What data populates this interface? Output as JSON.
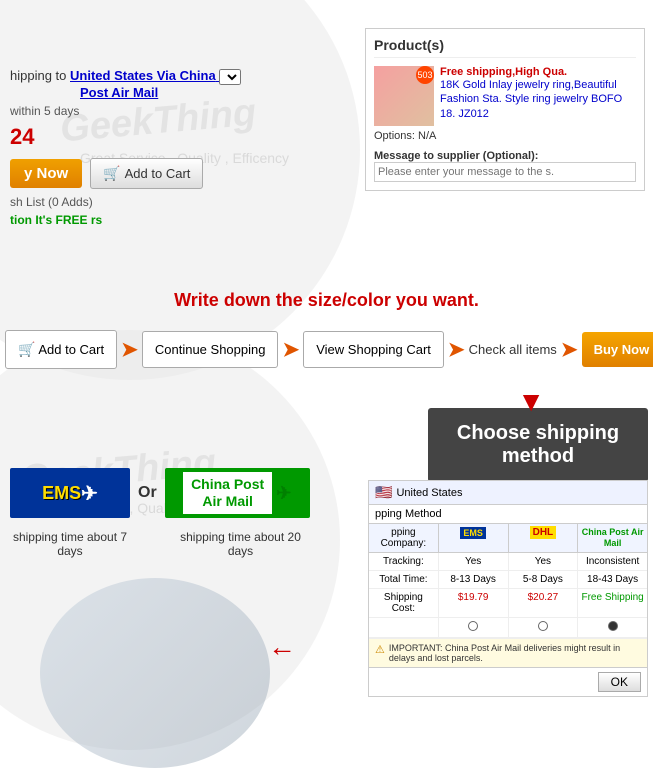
{
  "circles": {
    "circle1": {
      "class": "circle1"
    },
    "circle2": {
      "class": "circle2"
    }
  },
  "watermarks": {
    "text1": "GeekThing",
    "sub1": "Great Service , Quality , Efficency",
    "text2": "GeekThing",
    "sub2": "Great Service , Quality , Efficency"
  },
  "top": {
    "shipping_label": "hipping to",
    "shipping_link": "United States Via China",
    "shipping_method": "Post Air Mail",
    "shipping_days": "within 5 days",
    "price": "24",
    "buy_now": "y Now",
    "add_to_cart": "Add to Cart",
    "wish_list": "sh List (0 Adds)",
    "protection_label": "tion",
    "protection_free": "It's FREE",
    "protection_suffix": "rs"
  },
  "product_panel": {
    "title": "Product(s)",
    "badge": "503",
    "free_shipping": "Free shipping,High Qua.",
    "product_name": "18K Gold Inlay jewelry ring,Beautiful Fashion Sta. Style ring jewelry BOFO 18. JZ012",
    "options_label": "Options:",
    "options_value": "N/A",
    "message_label": "Message to supplier (Optional):",
    "message_placeholder": "Please enter your message to the s."
  },
  "red_text": "Write down the size/color you want.",
  "steps": {
    "add_cart": "Add to Cart",
    "continue": "Continue Shopping",
    "view_cart": "View Shopping Cart",
    "check": "Check all items",
    "buy_now": "Buy Now"
  },
  "choose_shipping": "Choose shipping method",
  "shipping_options": {
    "ems_text": "EMS",
    "or_text": "Or",
    "china_post_line1": "China Post",
    "china_post_line2": "Air Mail",
    "ems_time": "shipping time about 7 days",
    "china_post_time": "shipping time about 20 days"
  },
  "shipping_table": {
    "header": "United States",
    "subheader": "pping Method",
    "col1": "pping Company:",
    "col2": "",
    "col3": "",
    "col4": "China Post Air Mail",
    "row_tracking_label": "Tracking:",
    "row_tracking_ems": "Yes",
    "row_tracking_dhl": "Yes",
    "row_tracking_cp": "Inconsistent",
    "row_time_label": "Total Time:",
    "row_time_ems": "8-13 Days",
    "row_time_dhl": "5-8 Days",
    "row_time_cp": "18-43 Days",
    "row_cost_label": "Shipping Cost:",
    "row_cost_ems": "$19.79",
    "row_cost_dhl": "$20.27",
    "row_cost_cp": "Free Shipping",
    "important_text": "IMPORTANT: China Post Air Mail deliveries might result in delays and lost parcels.",
    "ok_btn": "OK"
  }
}
